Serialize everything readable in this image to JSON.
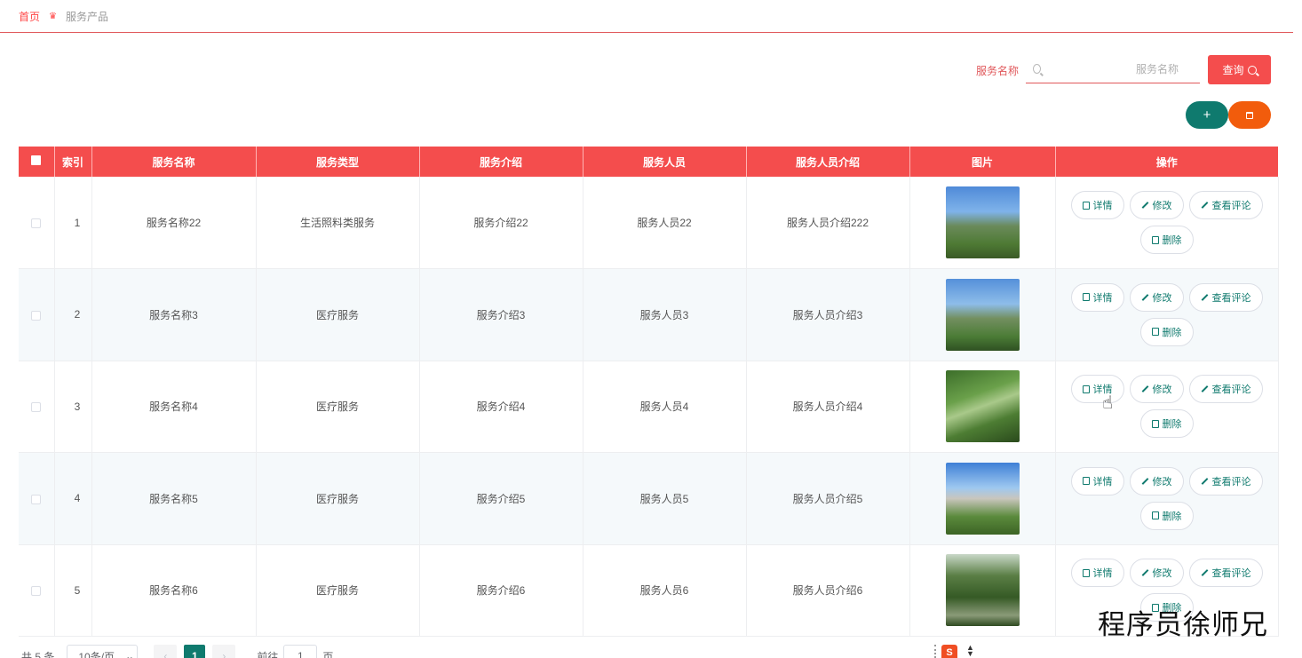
{
  "breadcrumb": {
    "home": "首页",
    "current": "服务产品"
  },
  "search": {
    "label": "服务名称",
    "placeholder": "服务名称",
    "query_label": "查询"
  },
  "actions": {
    "add_symbol": "+"
  },
  "table": {
    "headers": [
      "索引",
      "服务名称",
      "服务类型",
      "服务介绍",
      "服务人员",
      "服务人员介绍",
      "图片",
      "操作"
    ],
    "rows": [
      {
        "index": "1",
        "name": "服务名称22",
        "type": "生活照料类服务",
        "intro": "服务介绍22",
        "staff": "服务人员22",
        "staff_intro": "服务人员介绍222",
        "image": "building-park"
      },
      {
        "index": "2",
        "name": "服务名称3",
        "type": "医疗服务",
        "intro": "服务介绍3",
        "staff": "服务人员3",
        "staff_intro": "服务人员介绍3",
        "image": "building-park"
      },
      {
        "index": "3",
        "name": "服务名称4",
        "type": "医疗服务",
        "intro": "服务介绍4",
        "staff": "服务人员4",
        "staff_intro": "服务人员介绍4",
        "image": "garden-stream"
      },
      {
        "index": "4",
        "name": "服务名称5",
        "type": "医疗服务",
        "intro": "服务介绍5",
        "staff": "服务人员5",
        "staff_intro": "服务人员介绍5",
        "image": "tower-garden"
      },
      {
        "index": "5",
        "name": "服务名称6",
        "type": "医疗服务",
        "intro": "服务介绍6",
        "staff": "服务人员6",
        "staff_intro": "服务人员介绍6",
        "image": "forest-path"
      }
    ],
    "row_actions": {
      "detail": "详情",
      "edit": "修改",
      "comments": "查看评论",
      "delete": "删除"
    }
  },
  "pagination": {
    "total": "共 5 条",
    "page_size": "10条/页",
    "current_page": "1",
    "goto_prefix": "前往",
    "goto_value": "1",
    "goto_suffix": "页"
  },
  "watermark": "程序员徐师兄",
  "colors": {
    "primary_red": "#f44d4d",
    "teal": "#0f7a6e",
    "orange": "#f25c0c"
  }
}
